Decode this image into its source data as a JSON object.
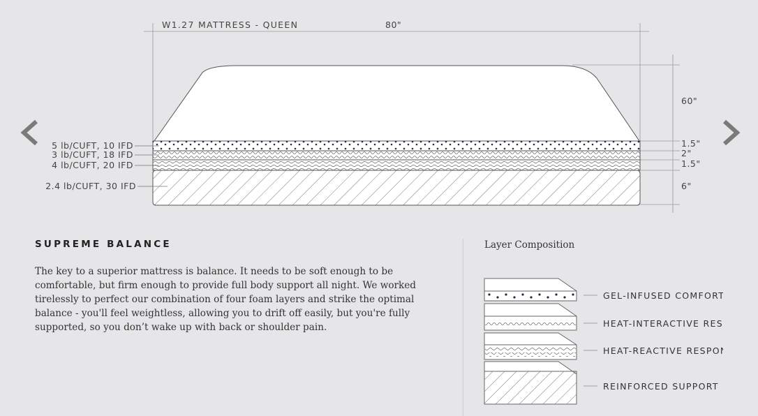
{
  "diagram": {
    "title": "W1.27 MATTRESS - QUEEN",
    "length": "80\"",
    "width": "60\"",
    "layer_heights": [
      "1.5\"",
      "2\"",
      "1.5\"",
      "6\""
    ],
    "layer_specs": [
      "5 lb/CUFT, 10 IFD",
      "3 lb/CUFT, 18 IFD",
      "4 lb/CUFT, 20 IFD",
      "2.4 lb/CUFT, 30 IFD"
    ]
  },
  "nav": {
    "prev_icon": "chevron-left-icon",
    "next_icon": "chevron-right-icon"
  },
  "content": {
    "heading": "SUPREME BALANCE",
    "body": "The key to a superior mattress is balance. It needs to be soft enough to be comfortable, but firm enough to provide full body support all night. We worked tirelessly to perfect our combination of four foam layers and strike the optimal balance - you'll feel weightless, allowing you to drift off easily, but you're fully supported, so you don’t wake up with back or shoulder pain."
  },
  "composition": {
    "title": "Layer Composition",
    "layers": [
      "GEL-INFUSED COMFORT",
      "HEAT-INTERACTIVE RESI",
      "HEAT-REACTIVE RESPON",
      "REINFORCED SUPPORT L"
    ]
  },
  "colors": {
    "background": "#e6e6e8",
    "line": "#555555",
    "dot": "#1f2e45"
  }
}
